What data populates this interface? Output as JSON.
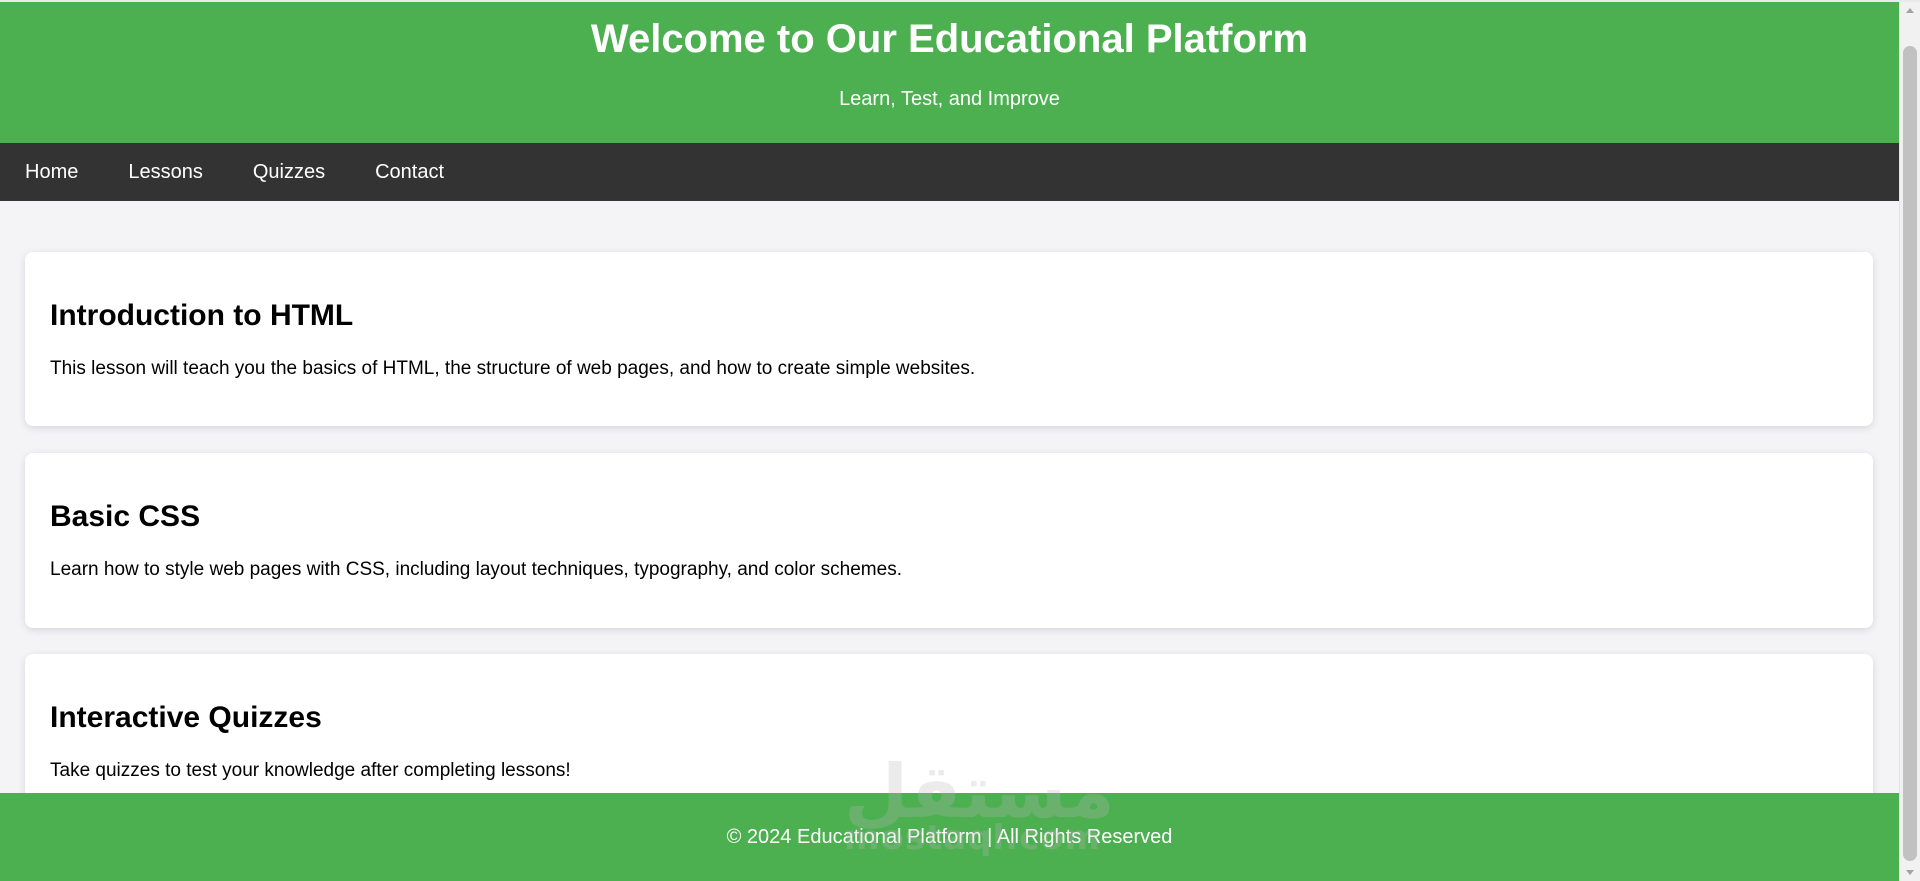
{
  "header": {
    "title": "Welcome to Our Educational Platform",
    "subtitle": "Learn, Test, and Improve"
  },
  "nav": {
    "items": [
      {
        "label": "Home"
      },
      {
        "label": "Lessons"
      },
      {
        "label": "Quizzes"
      },
      {
        "label": "Contact"
      }
    ]
  },
  "lessons": [
    {
      "title": "Introduction to HTML",
      "description": "This lesson will teach you the basics of HTML, the structure of web pages, and how to create simple websites."
    },
    {
      "title": "Basic CSS",
      "description": "Learn how to style web pages with CSS, including layout techniques, typography, and color schemes."
    },
    {
      "title": "Interactive Quizzes",
      "description": "Take quizzes to test your knowledge after completing lessons!"
    }
  ],
  "footer": {
    "text": "© 2024 Educational Platform | All Rights Reserved"
  },
  "watermark": {
    "arabic": "مستقل",
    "latin": "mostaql.com"
  },
  "colors": {
    "brand_green": "#4caf50",
    "nav_dark": "#333333",
    "page_bg": "#f4f4f7",
    "card_bg": "#ffffff"
  }
}
